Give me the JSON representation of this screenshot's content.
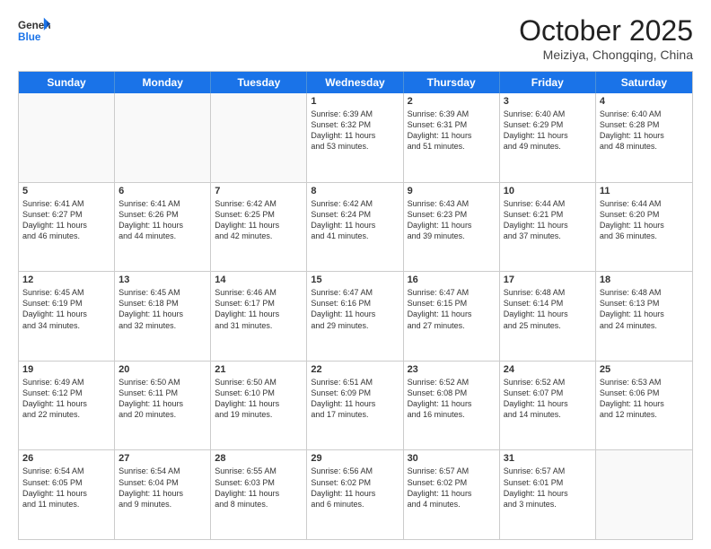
{
  "header": {
    "logo_general": "General",
    "logo_blue": "Blue",
    "month_title": "October 2025",
    "location": "Meiziya, Chongqing, China"
  },
  "weekdays": [
    "Sunday",
    "Monday",
    "Tuesday",
    "Wednesday",
    "Thursday",
    "Friday",
    "Saturday"
  ],
  "rows": [
    [
      {
        "day": "",
        "text": ""
      },
      {
        "day": "",
        "text": ""
      },
      {
        "day": "",
        "text": ""
      },
      {
        "day": "1",
        "text": "Sunrise: 6:39 AM\nSunset: 6:32 PM\nDaylight: 11 hours\nand 53 minutes."
      },
      {
        "day": "2",
        "text": "Sunrise: 6:39 AM\nSunset: 6:31 PM\nDaylight: 11 hours\nand 51 minutes."
      },
      {
        "day": "3",
        "text": "Sunrise: 6:40 AM\nSunset: 6:29 PM\nDaylight: 11 hours\nand 49 minutes."
      },
      {
        "day": "4",
        "text": "Sunrise: 6:40 AM\nSunset: 6:28 PM\nDaylight: 11 hours\nand 48 minutes."
      }
    ],
    [
      {
        "day": "5",
        "text": "Sunrise: 6:41 AM\nSunset: 6:27 PM\nDaylight: 11 hours\nand 46 minutes."
      },
      {
        "day": "6",
        "text": "Sunrise: 6:41 AM\nSunset: 6:26 PM\nDaylight: 11 hours\nand 44 minutes."
      },
      {
        "day": "7",
        "text": "Sunrise: 6:42 AM\nSunset: 6:25 PM\nDaylight: 11 hours\nand 42 minutes."
      },
      {
        "day": "8",
        "text": "Sunrise: 6:42 AM\nSunset: 6:24 PM\nDaylight: 11 hours\nand 41 minutes."
      },
      {
        "day": "9",
        "text": "Sunrise: 6:43 AM\nSunset: 6:23 PM\nDaylight: 11 hours\nand 39 minutes."
      },
      {
        "day": "10",
        "text": "Sunrise: 6:44 AM\nSunset: 6:21 PM\nDaylight: 11 hours\nand 37 minutes."
      },
      {
        "day": "11",
        "text": "Sunrise: 6:44 AM\nSunset: 6:20 PM\nDaylight: 11 hours\nand 36 minutes."
      }
    ],
    [
      {
        "day": "12",
        "text": "Sunrise: 6:45 AM\nSunset: 6:19 PM\nDaylight: 11 hours\nand 34 minutes."
      },
      {
        "day": "13",
        "text": "Sunrise: 6:45 AM\nSunset: 6:18 PM\nDaylight: 11 hours\nand 32 minutes."
      },
      {
        "day": "14",
        "text": "Sunrise: 6:46 AM\nSunset: 6:17 PM\nDaylight: 11 hours\nand 31 minutes."
      },
      {
        "day": "15",
        "text": "Sunrise: 6:47 AM\nSunset: 6:16 PM\nDaylight: 11 hours\nand 29 minutes."
      },
      {
        "day": "16",
        "text": "Sunrise: 6:47 AM\nSunset: 6:15 PM\nDaylight: 11 hours\nand 27 minutes."
      },
      {
        "day": "17",
        "text": "Sunrise: 6:48 AM\nSunset: 6:14 PM\nDaylight: 11 hours\nand 25 minutes."
      },
      {
        "day": "18",
        "text": "Sunrise: 6:48 AM\nSunset: 6:13 PM\nDaylight: 11 hours\nand 24 minutes."
      }
    ],
    [
      {
        "day": "19",
        "text": "Sunrise: 6:49 AM\nSunset: 6:12 PM\nDaylight: 11 hours\nand 22 minutes."
      },
      {
        "day": "20",
        "text": "Sunrise: 6:50 AM\nSunset: 6:11 PM\nDaylight: 11 hours\nand 20 minutes."
      },
      {
        "day": "21",
        "text": "Sunrise: 6:50 AM\nSunset: 6:10 PM\nDaylight: 11 hours\nand 19 minutes."
      },
      {
        "day": "22",
        "text": "Sunrise: 6:51 AM\nSunset: 6:09 PM\nDaylight: 11 hours\nand 17 minutes."
      },
      {
        "day": "23",
        "text": "Sunrise: 6:52 AM\nSunset: 6:08 PM\nDaylight: 11 hours\nand 16 minutes."
      },
      {
        "day": "24",
        "text": "Sunrise: 6:52 AM\nSunset: 6:07 PM\nDaylight: 11 hours\nand 14 minutes."
      },
      {
        "day": "25",
        "text": "Sunrise: 6:53 AM\nSunset: 6:06 PM\nDaylight: 11 hours\nand 12 minutes."
      }
    ],
    [
      {
        "day": "26",
        "text": "Sunrise: 6:54 AM\nSunset: 6:05 PM\nDaylight: 11 hours\nand 11 minutes."
      },
      {
        "day": "27",
        "text": "Sunrise: 6:54 AM\nSunset: 6:04 PM\nDaylight: 11 hours\nand 9 minutes."
      },
      {
        "day": "28",
        "text": "Sunrise: 6:55 AM\nSunset: 6:03 PM\nDaylight: 11 hours\nand 8 minutes."
      },
      {
        "day": "29",
        "text": "Sunrise: 6:56 AM\nSunset: 6:02 PM\nDaylight: 11 hours\nand 6 minutes."
      },
      {
        "day": "30",
        "text": "Sunrise: 6:57 AM\nSunset: 6:02 PM\nDaylight: 11 hours\nand 4 minutes."
      },
      {
        "day": "31",
        "text": "Sunrise: 6:57 AM\nSunset: 6:01 PM\nDaylight: 11 hours\nand 3 minutes."
      },
      {
        "day": "",
        "text": ""
      }
    ]
  ]
}
